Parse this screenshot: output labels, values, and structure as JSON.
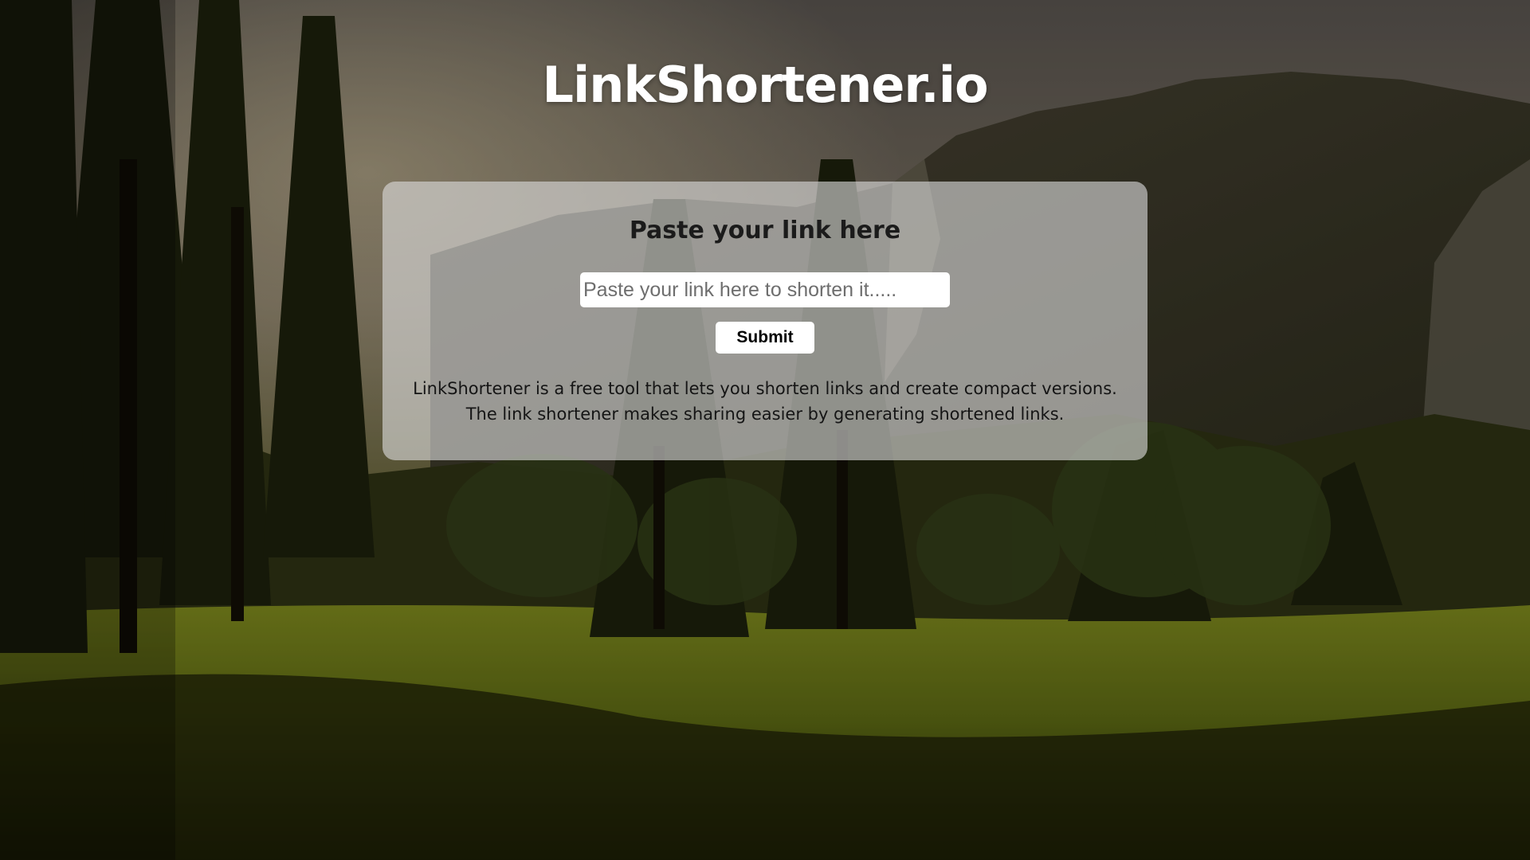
{
  "site": {
    "title": "LinkShortener.io"
  },
  "card": {
    "heading": "Paste your link here",
    "input_placeholder": "Paste your link here to shorten it.....",
    "input_value": "",
    "submit_label": "Submit",
    "description_line1": "LinkShortener is a free tool that lets you shorten links and create compact versions.",
    "description_line2": "The link shortener makes sharing easier by generating shortened links."
  },
  "colors": {
    "title_text": "#ffffff",
    "card_background": "rgba(220,220,220,0.62)",
    "body_text": "#151515"
  }
}
